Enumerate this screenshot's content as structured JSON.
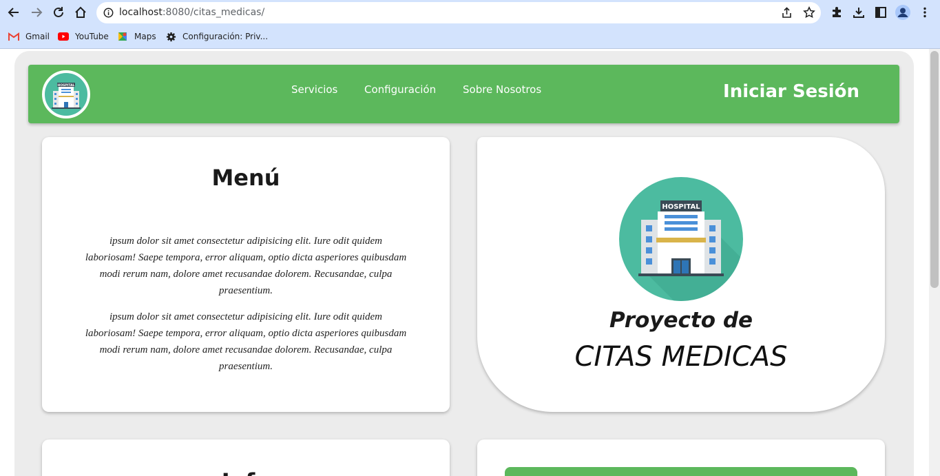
{
  "browser": {
    "url_host": "localhost",
    "url_path": ":8080/citas_medicas/",
    "bookmarks": [
      {
        "label": "Gmail",
        "icon": "gmail-icon"
      },
      {
        "label": "YouTube",
        "icon": "youtube-icon"
      },
      {
        "label": "Maps",
        "icon": "maps-icon"
      },
      {
        "label": "Configuración: Priv...",
        "icon": "gear-icon"
      }
    ]
  },
  "header": {
    "nav": [
      "Servicios",
      "Configuración",
      "Sobre Nosotros"
    ],
    "login": "Iniciar Sesión",
    "logo_text": "HOSPITAL"
  },
  "menu_card": {
    "title": "Menú",
    "paragraphs": [
      "ipsum dolor sit amet consectetur adipisicing elit. Iure odit quidem laboriosam! Saepe tempora, error aliquam, optio dicta asperiores quibusdam modi rerum nam, dolore amet recusandae dolorem. Recusandae, culpa praesentium.",
      "ipsum dolor sit amet consectetur adipisicing elit. Iure odit quidem laboriosam! Saepe tempora, error aliquam, optio dicta asperiores quibusdam modi rerum nam, dolore amet recusandae dolorem. Recusandae, culpa praesentium."
    ]
  },
  "project_card": {
    "hospital_label": "HOSPITAL",
    "subtitle": "Proyecto de",
    "title": "CITAS MEDICAS"
  },
  "info_card": {
    "title": "Info"
  },
  "colors": {
    "header_green": "#5cb85c",
    "hospital_teal": "#4cbba0",
    "chrome_blue": "#d3e3fd"
  }
}
